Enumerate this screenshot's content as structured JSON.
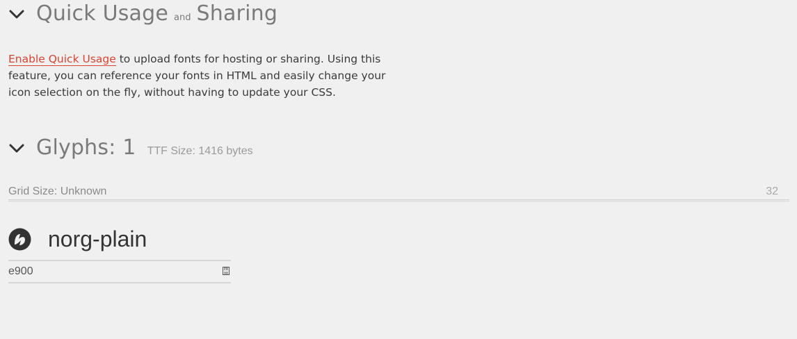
{
  "quick_usage": {
    "title_part1": "Quick Usage",
    "title_connector": "and",
    "title_part2": "Sharing",
    "link_text": "Enable Quick Usage",
    "description": " to upload fonts for hosting or sharing. Using this feature, you can reference your fonts in HTML and easily change your icon selection on the fly, without having to update your CSS."
  },
  "glyphs": {
    "title": "Glyphs: 1",
    "ttf_size": "TTF Size: 1416 bytes"
  },
  "grid": {
    "label": "Grid Size: Unknown",
    "value": "32"
  },
  "glyph_items": [
    {
      "name": "norg-plain",
      "code": "e900",
      "icon": "norg-logo-icon"
    }
  ],
  "icons": {
    "chevron": "chevron-down-icon",
    "hex_toggle": "hex-code-icon"
  }
}
